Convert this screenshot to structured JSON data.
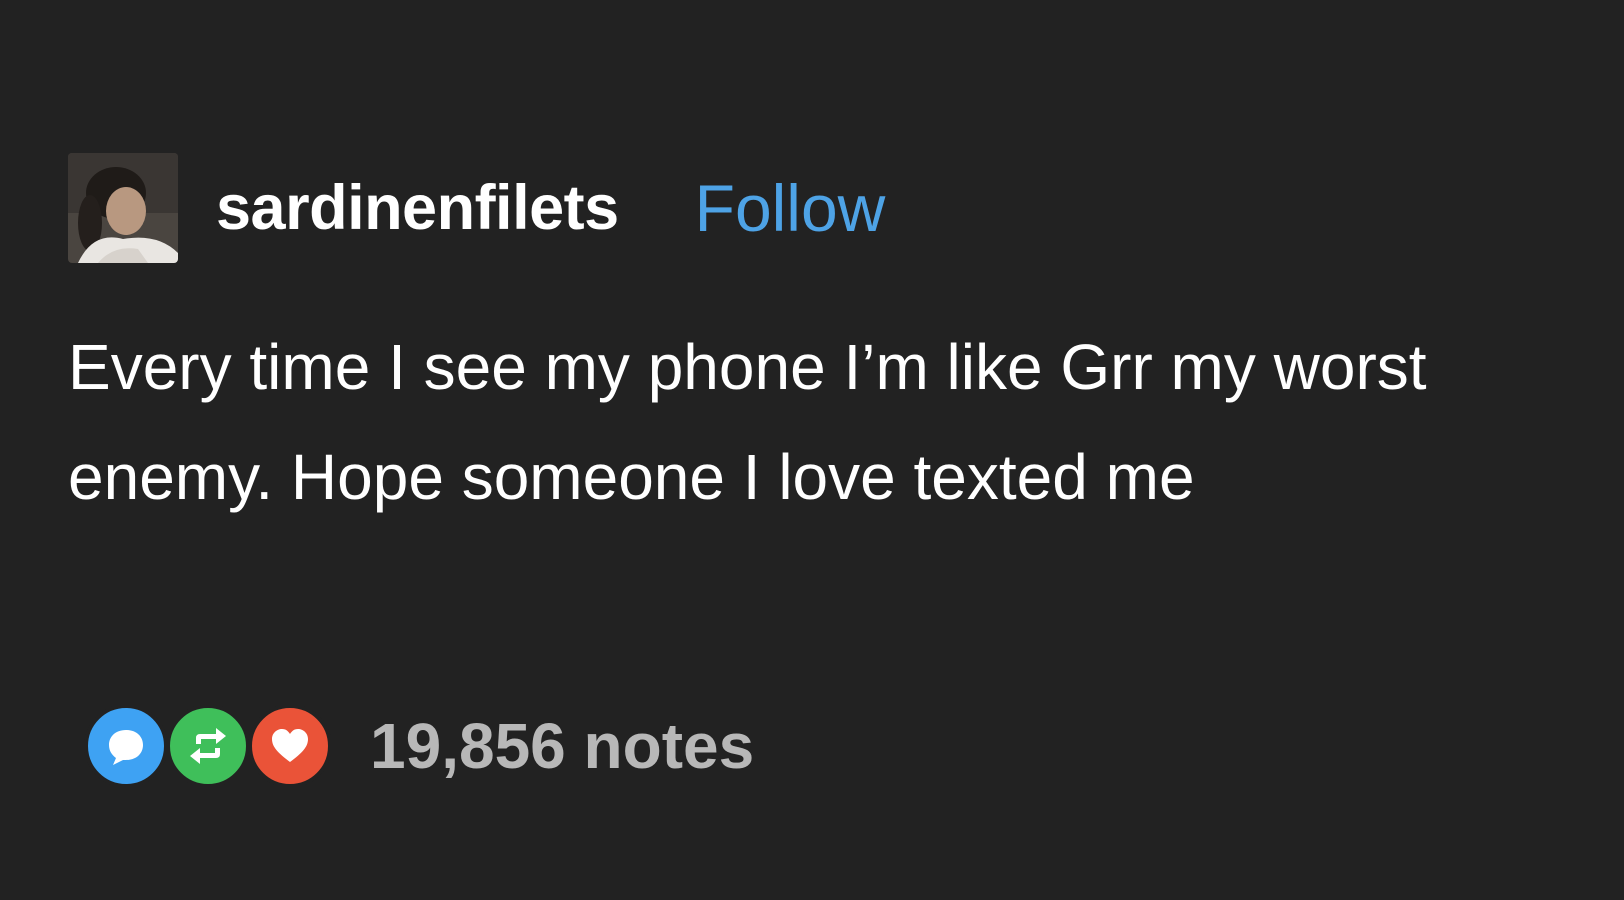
{
  "post": {
    "username": "sardinenfilets",
    "follow_label": "Follow",
    "body": "Every time I see my phone I’m like Grr my worst enemy. Hope someone I love texted me",
    "notes_label": "19,856 notes"
  },
  "icons": {
    "avatar": "avatar-photo",
    "reply": "reply-speech-bubble-icon",
    "reblog": "reblog-arrows-icon",
    "like": "heart-icon"
  },
  "colors": {
    "background": "#222222",
    "text": "#ffffff",
    "follow": "#4ea3e6",
    "notes": "#b8b8b8",
    "reply": "#3ea2f3",
    "reblog": "#3fbf5a",
    "like": "#ea5338"
  }
}
